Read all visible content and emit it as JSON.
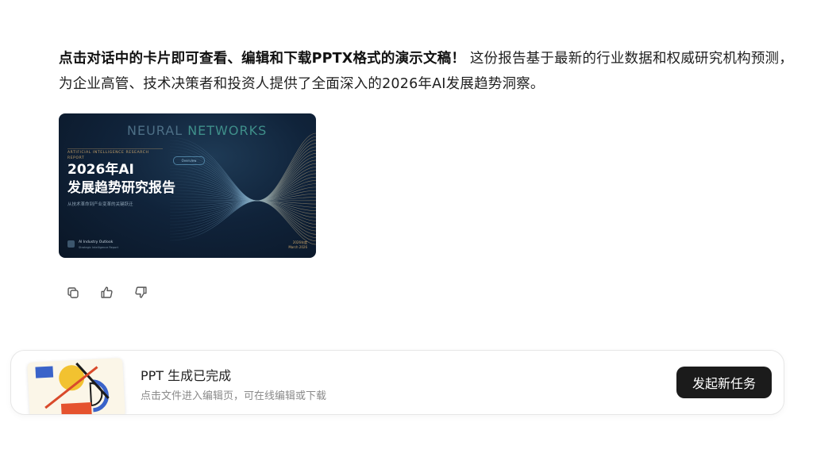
{
  "message": {
    "bold": "点击对话中的卡片即可查看、编辑和下载PPTX格式的演示文稿！",
    "text": " 这份报告基于最新的行业数据和权威研究机构预测，为企业高管、技术决策者和投资人提供了全面深入的2026年AI发展趋势洞察。"
  },
  "slide_card": {
    "brand_part1": "NEURAL ",
    "brand_part2": "NETWORKS",
    "tag": "ARTIFICIAL INTELLIGENCE RESEARCH REPORT",
    "title_line1": "2026年AI",
    "title_line2": "发展趋势研究报告",
    "subtitle": "从技术革命到产业变革的关键跃迁",
    "pill": "Overview",
    "footer_left_1": "AI Industry Outlook",
    "footer_left_2": "Strategic Intelligence Report",
    "footer_right_1": "2026年度",
    "footer_right_2": "March 2026"
  },
  "actions": {
    "copy_icon": "copy-icon",
    "like_icon": "thumbs-up-icon",
    "dislike_icon": "thumbs-down-icon"
  },
  "status_bar": {
    "title": "PPT 生成已完成",
    "subtitle": "点击文件进入编辑页，可在线编辑或下载",
    "button_label": "发起新任务"
  }
}
